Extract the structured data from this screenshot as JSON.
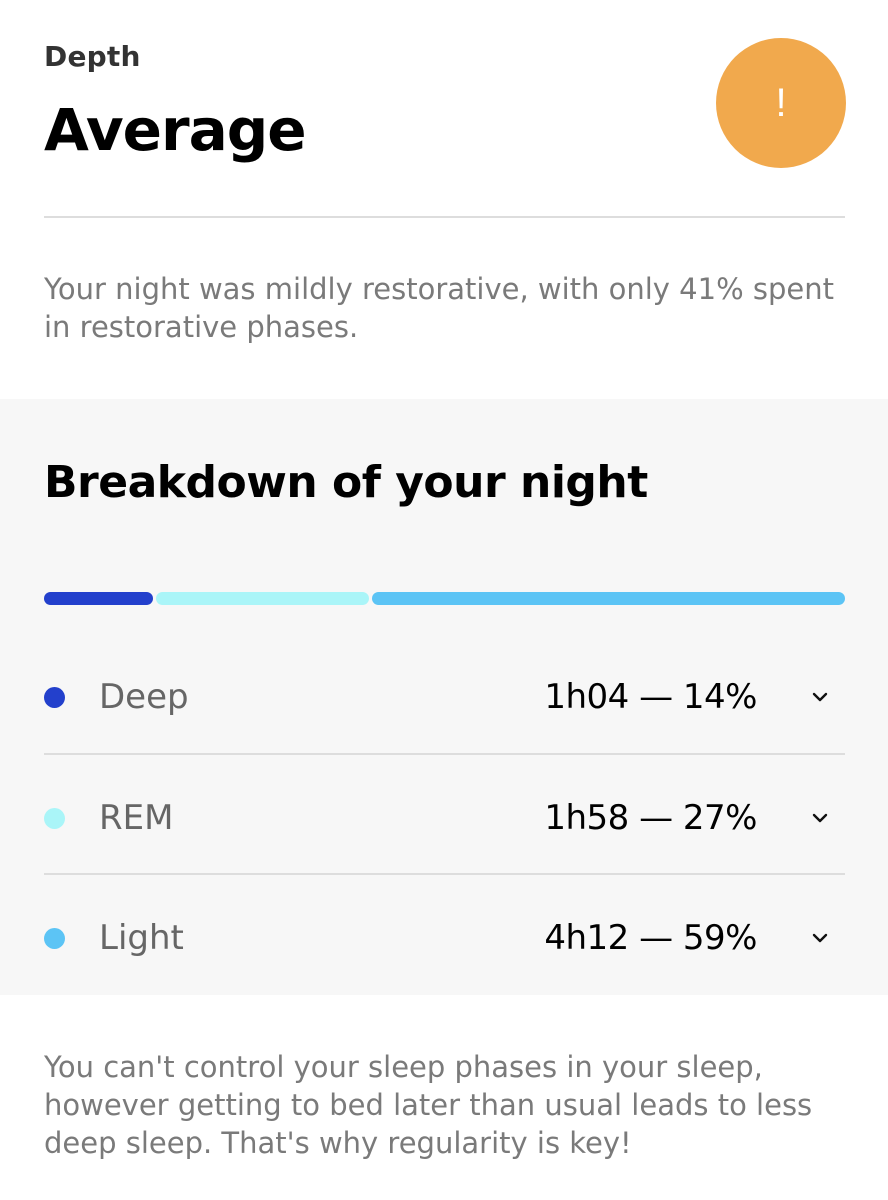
{
  "header": {
    "eyebrow": "Depth",
    "title": "Average",
    "badge_symbol": "!",
    "badge_color": "#f1a94d"
  },
  "summary": "Your night was mildly restorative, with only 41% spent in restorative phases.",
  "breakdown": {
    "title": "Breakdown of your night",
    "phases": [
      {
        "name": "Deep",
        "value": "1h04 — 14%",
        "percent": 14,
        "color": "#2340cc"
      },
      {
        "name": "REM",
        "value": "1h58 — 27%",
        "percent": 27,
        "color": "#aaf5f8"
      },
      {
        "name": "Light",
        "value": "4h12 — 59%",
        "percent": 59,
        "color": "#5cc4f5"
      }
    ]
  },
  "footer": "You can't control your sleep phases in your sleep, however getting to bed later than usual leads to less deep sleep. That's why regularity is key!"
}
